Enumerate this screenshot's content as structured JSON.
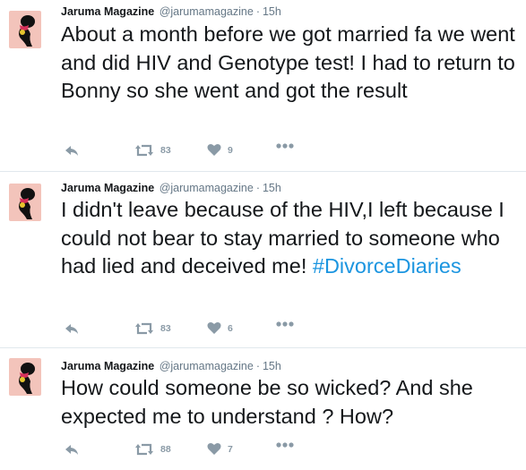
{
  "colors": {
    "avatar_bg": "#f3c4bb",
    "hashtag": "#1b95e0",
    "muted": "#657786",
    "icon": "#8a9aa6",
    "divider": "#e1e8ed"
  },
  "tweets": [
    {
      "author": "Jaruma Magazine",
      "handle": "@jarumamagazine",
      "separator": "·",
      "time": "15h",
      "text": "About a month before we got married fa we went and did HIV and Genotype test! I had to return to Bonny so she went and got the result",
      "hashtag": "",
      "retweets": "83",
      "likes": "9",
      "icons": [
        "reply-icon",
        "retweet-icon",
        "heart-icon",
        "more-icon"
      ]
    },
    {
      "author": "Jaruma Magazine",
      "handle": "@jarumamagazine",
      "separator": "·",
      "time": "15h",
      "text": "I didn't leave because of the HIV,I left because I could not bear to stay married to someone who had lied and deceived me!",
      "hashtag": "#DivorceDiaries",
      "retweets": "83",
      "likes": "6",
      "icons": [
        "reply-icon",
        "retweet-icon",
        "heart-icon",
        "more-icon"
      ]
    },
    {
      "author": "Jaruma Magazine",
      "handle": "@jarumamagazine",
      "separator": "·",
      "time": "15h",
      "text": "How could someone be so wicked? And she expected me to understand ? How?",
      "hashtag": "",
      "retweets": "88",
      "likes": "7",
      "icons": [
        "reply-icon",
        "retweet-icon",
        "heart-icon",
        "more-icon"
      ]
    }
  ]
}
